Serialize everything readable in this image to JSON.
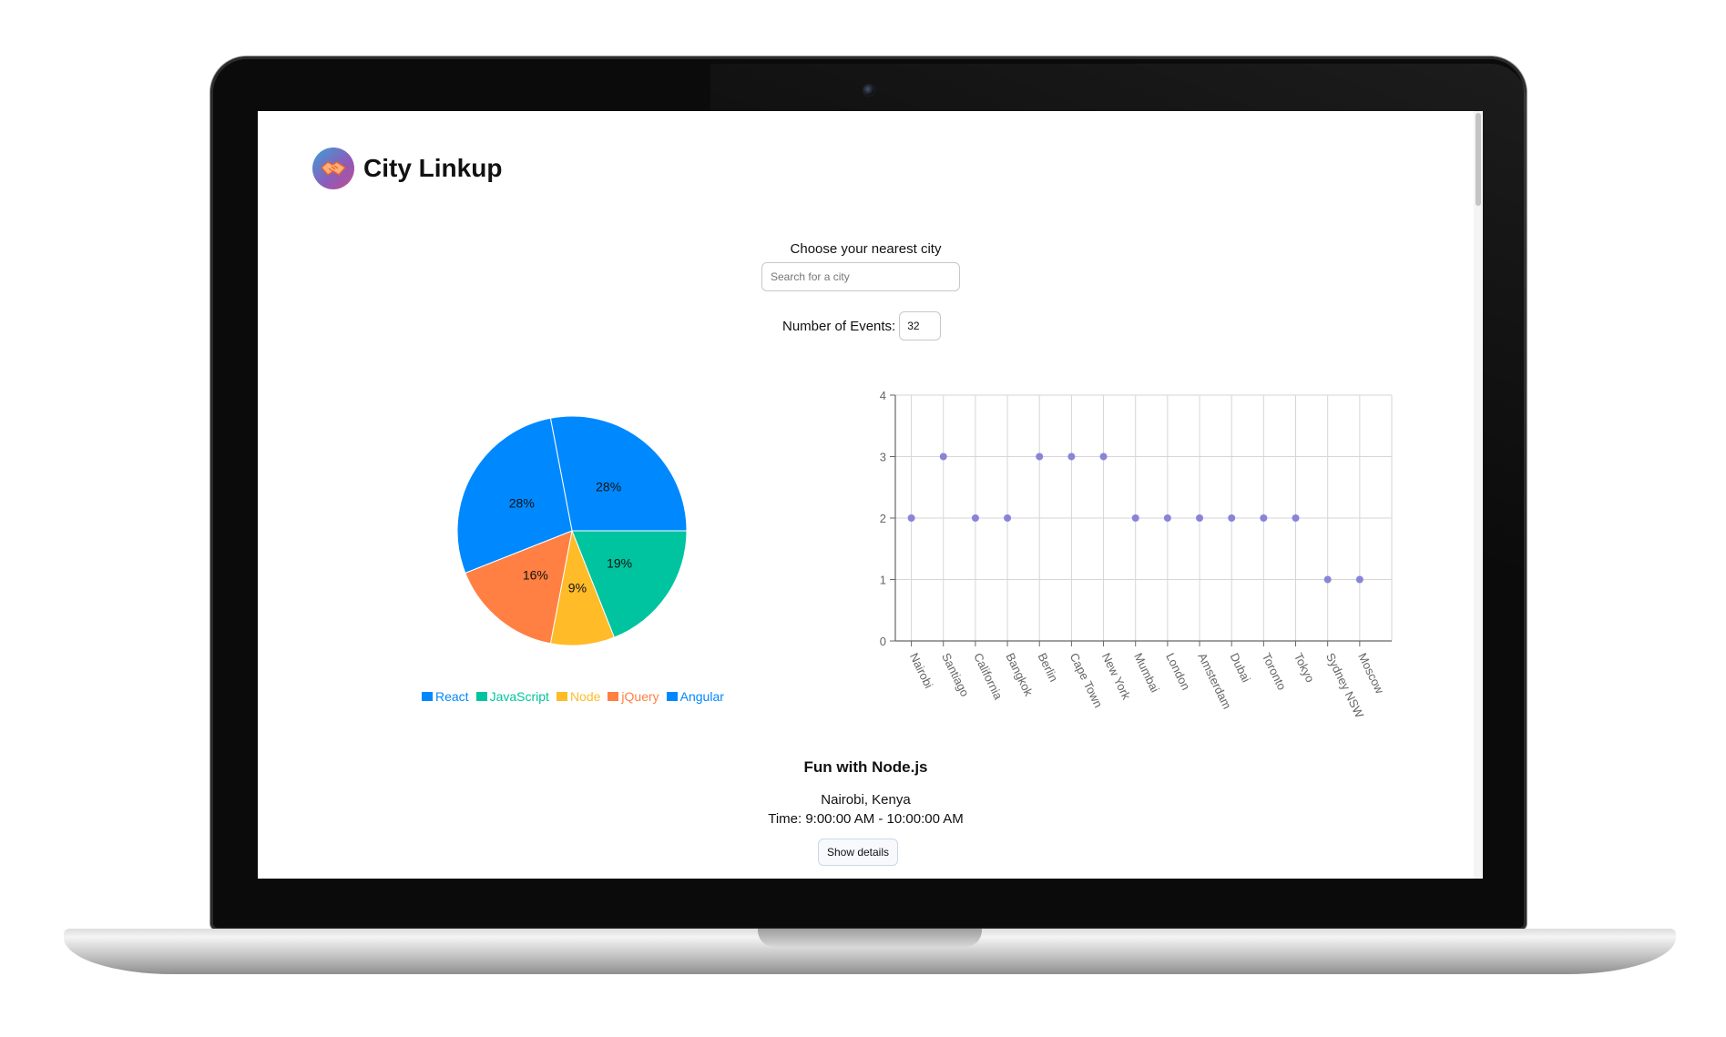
{
  "app": {
    "title": "City Linkup",
    "logo_icon": "handshake-icon"
  },
  "search": {
    "label": "Choose your nearest city",
    "placeholder": "Search for a city",
    "value": ""
  },
  "events": {
    "label": "Number of Events:",
    "value": "32"
  },
  "colors": {
    "react": "#0088fe",
    "javascript": "#00c49f",
    "node": "#ffbb28",
    "jquery": "#ff8042",
    "angular": "#0088fe",
    "scatter_point": "#8884d8"
  },
  "chart_data": [
    {
      "type": "pie",
      "slices": [
        {
          "name": "React",
          "value": 28,
          "label": "28%",
          "color": "#0088fe"
        },
        {
          "name": "JavaScript",
          "value": 19,
          "label": "19%",
          "color": "#00c49f"
        },
        {
          "name": "Node",
          "value": 9,
          "label": "9%",
          "color": "#ffbb28"
        },
        {
          "name": "jQuery",
          "value": 16,
          "label": "16%",
          "color": "#ff8042"
        },
        {
          "name": "Angular",
          "value": 28,
          "label": "28%",
          "color": "#0088fe"
        }
      ],
      "legend": [
        {
          "name": "React",
          "color": "#0088fe"
        },
        {
          "name": "JavaScript",
          "color": "#00c49f"
        },
        {
          "name": "Node",
          "color": "#ffbb28"
        },
        {
          "name": "jQuery",
          "color": "#ff8042"
        },
        {
          "name": "Angular",
          "color": "#0088fe"
        }
      ],
      "legend_position": "bottom"
    },
    {
      "type": "scatter",
      "categories": [
        "Nairobi",
        "Santiago",
        "California",
        "Bangkok",
        "Berlin",
        "Cape Town",
        "New York",
        "Mumbai",
        "London",
        "Amsterdam",
        "Dubai",
        "Toronto",
        "Tokyo",
        "Sydney NSW",
        "Moscow"
      ],
      "values": [
        2,
        3,
        2,
        2,
        3,
        3,
        3,
        2,
        2,
        2,
        2,
        2,
        2,
        1,
        1
      ],
      "ylim": [
        0,
        4
      ],
      "yticks": [
        "0",
        "1",
        "2",
        "3",
        "4"
      ],
      "grid": true
    }
  ],
  "event": {
    "title": "Fun with Node.js",
    "location": "Nairobi, Kenya",
    "time": "Time: 9:00:00 AM - 10:00:00 AM",
    "details_button": "Show details"
  }
}
